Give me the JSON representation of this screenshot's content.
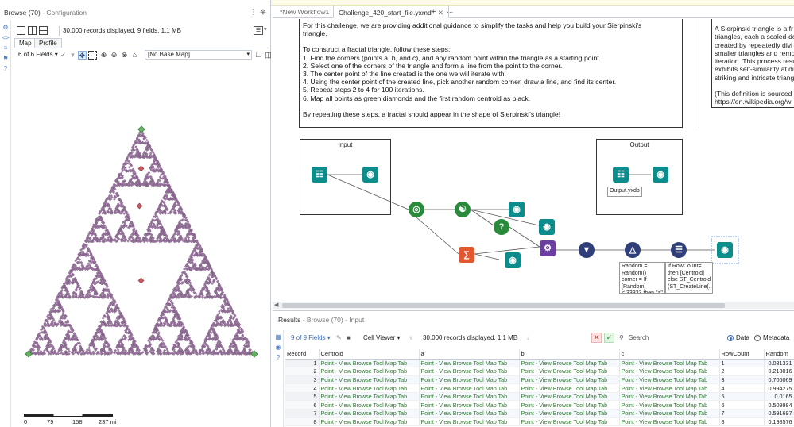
{
  "browse": {
    "title": "Browse (70)",
    "subtitle": " - Configuration",
    "info": "30,000 records displayed, 9 fields, 1.1 MB",
    "tab_map": "Map",
    "tab_profile": "Profile",
    "fields": "6 of 6 Fields",
    "basemap": "[No Base Map]",
    "scale": [
      "0",
      "79",
      "158",
      "237 mi"
    ]
  },
  "tabs": {
    "tab1": "*New Workflow1",
    "tab2": "Challenge_420_start_file.yxmd",
    "add": "+",
    "more": "···"
  },
  "instructions": {
    "line1": "For this challenge, we are providing additional guidance to simplify the tasks and help you build your Sierpinski's",
    "line2": "triangle.",
    "line3": "To construct a fractal triangle, follow these steps:",
    "step1": "1. Find the corners (points a, b, and c), and any random point within the triangle as a starting point.",
    "step2": "2. Select one of the corners of the triangle and form a line from the point to the corner.",
    "step3": "3. The center point of the line created is the one we will iterate with.",
    "step4": "4. Using the center point of the created line, pick another random corner, draw a line, and find its center.",
    "step5": "5. Repeat steps 2 to 4 for 100 iterations.",
    "step6": "6. Map all points as green diamonds and the first random centroid as black.",
    "closing": "By repeating these steps, a fractal should appear in the shape of Sierpinski's triangle!"
  },
  "definition": {
    "l1": "A Sierpinski triangle is a fr",
    "l2": "triangles, each a scaled-do",
    "l3": "created by repeatedly divi",
    "l4": "smaller triangles and remo",
    "l5": "iteration. This process resu",
    "l6": "exhibits self-similarity at di",
    "l7": "striking and intricate triang",
    "l8": "(This definition is sourced f",
    "l9": "https://en.wikipedia.org/w"
  },
  "containers": {
    "input": "Input",
    "output": "Output",
    "output_file": "Output.yxdb"
  },
  "annotations": {
    "formula": "Random =\nRandom()\ncorner = If\n[Random]\n<.33333 then \"a\"\nelseif [Random]",
    "multirow": "If RowCount=1\nthen [Centroid]\nelse ST_Centroid\n(ST_CreateLine(..."
  },
  "results": {
    "title": "Results",
    "subtitle": " - Browse (70) - Input",
    "fields": "9 of 9 Fields",
    "viewer": "Cell Viewer",
    "info": "30,000 records displayed, 1.1 MB",
    "search": "Search",
    "data": "Data",
    "metadata": "Metadata",
    "columns": [
      "Record",
      "Centroid",
      "a",
      "b",
      "c",
      "RowCount",
      "Random"
    ],
    "rows": [
      {
        "rec": "1",
        "centroid": "Point - View Browse Tool Map Tab",
        "a": "Point - View Browse Tool Map Tab",
        "b": "Point - View Browse Tool Map Tab",
        "c": "Point - View Browse Tool Map Tab",
        "rowcount": "1",
        "random": "0.081331"
      },
      {
        "rec": "2",
        "centroid": "Point - View Browse Tool Map Tab",
        "a": "Point - View Browse Tool Map Tab",
        "b": "Point - View Browse Tool Map Tab",
        "c": "Point - View Browse Tool Map Tab",
        "rowcount": "2",
        "random": "0.213016"
      },
      {
        "rec": "3",
        "centroid": "Point - View Browse Tool Map Tab",
        "a": "Point - View Browse Tool Map Tab",
        "b": "Point - View Browse Tool Map Tab",
        "c": "Point - View Browse Tool Map Tab",
        "rowcount": "3",
        "random": "0.706069"
      },
      {
        "rec": "4",
        "centroid": "Point - View Browse Tool Map Tab",
        "a": "Point - View Browse Tool Map Tab",
        "b": "Point - View Browse Tool Map Tab",
        "c": "Point - View Browse Tool Map Tab",
        "rowcount": "4",
        "random": "0.994275"
      },
      {
        "rec": "5",
        "centroid": "Point - View Browse Tool Map Tab",
        "a": "Point - View Browse Tool Map Tab",
        "b": "Point - View Browse Tool Map Tab",
        "c": "Point - View Browse Tool Map Tab",
        "rowcount": "5",
        "random": "0.0165"
      },
      {
        "rec": "6",
        "centroid": "Point - View Browse Tool Map Tab",
        "a": "Point - View Browse Tool Map Tab",
        "b": "Point - View Browse Tool Map Tab",
        "c": "Point - View Browse Tool Map Tab",
        "rowcount": "6",
        "random": "0.509984"
      },
      {
        "rec": "7",
        "centroid": "Point - View Browse Tool Map Tab",
        "a": "Point - View Browse Tool Map Tab",
        "b": "Point - View Browse Tool Map Tab",
        "c": "Point - View Browse Tool Map Tab",
        "rowcount": "7",
        "random": "0.591697"
      },
      {
        "rec": "8",
        "centroid": "Point - View Browse Tool Map Tab",
        "a": "Point - View Browse Tool Map Tab",
        "b": "Point - View Browse Tool Map Tab",
        "c": "Point - View Browse Tool Map Tab",
        "rowcount": "8",
        "random": "0.198576"
      }
    ]
  },
  "colors": {
    "fractal": "#a27fa6",
    "corner": "#5fae5f",
    "seed": "#c8575f",
    "tool_teal": "#0c8d8c",
    "tool_green": "#2a8a3c",
    "accent_blue": "#3a6db8"
  },
  "icons": {
    "rail": [
      "gear-icon",
      "code-icon",
      "sliders-icon",
      "tag-icon",
      "help-icon"
    ],
    "map_toolbar": [
      "select-icon",
      "pan-icon",
      "box-select-icon",
      "zoom-in-icon",
      "zoom-out-icon",
      "zoom-extent-icon",
      "home-icon"
    ]
  }
}
